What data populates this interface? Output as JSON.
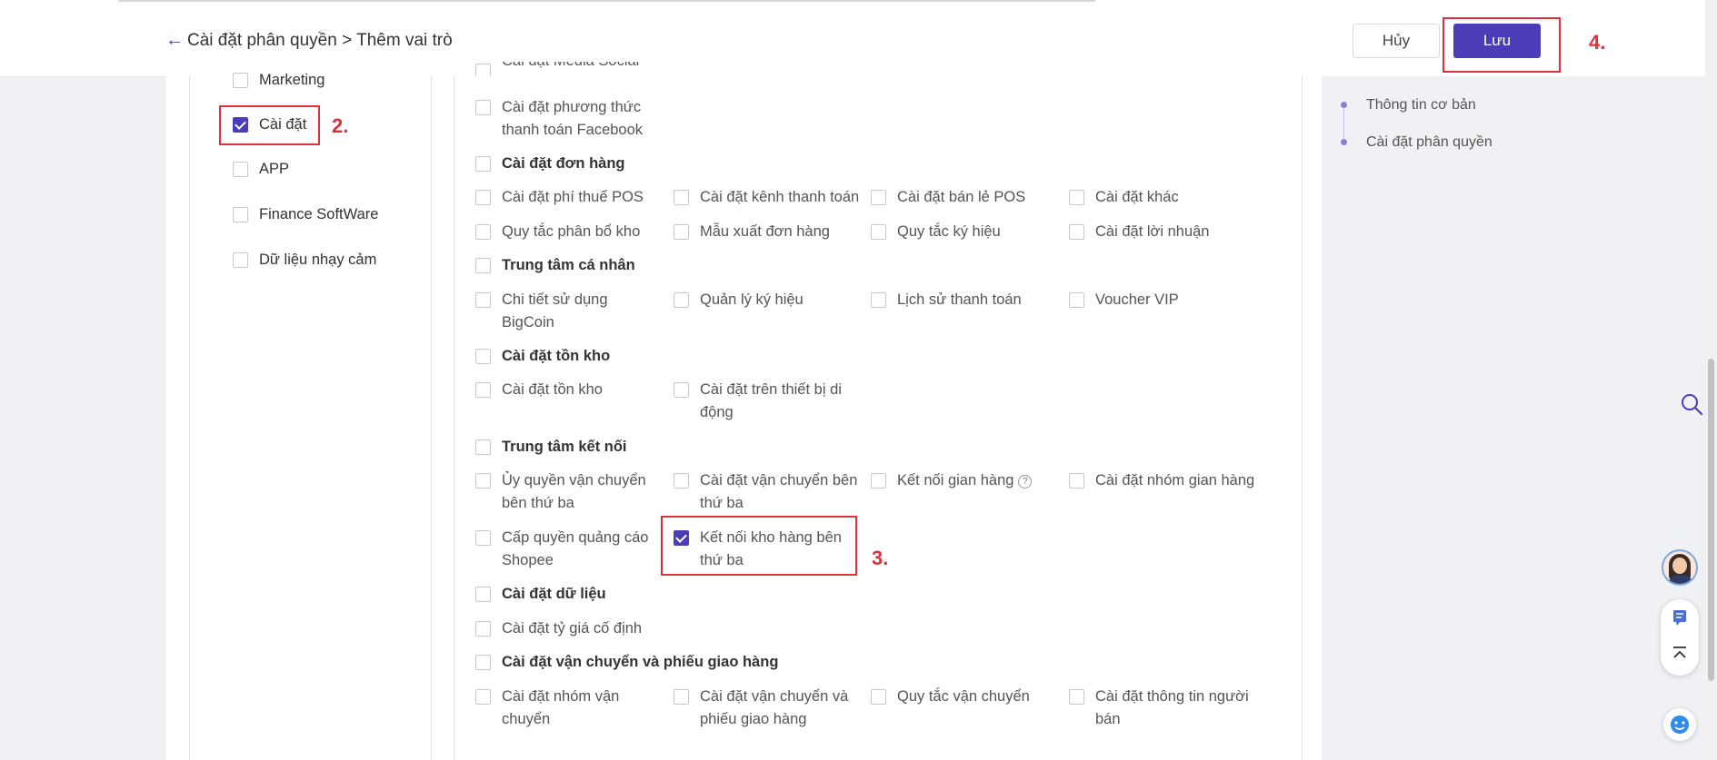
{
  "header": {
    "back_arrow": "←",
    "breadcrumb": "Cài đặt phân quyền > Thêm vai trò",
    "cancel_label": "Hủy",
    "save_label": "Lưu"
  },
  "steps": {
    "step2": "2.",
    "step3": "3.",
    "step4": "4."
  },
  "left_menu": [
    {
      "label": "Marketing",
      "checked": false
    },
    {
      "label": "Cài đặt",
      "checked": true
    },
    {
      "label": "APP",
      "checked": false
    },
    {
      "label": "Finance SoftWare",
      "checked": false
    },
    {
      "label": "Dữ liệu nhạy cảm",
      "checked": false
    }
  ],
  "permissions": {
    "social_partial": "Cài đặt Media Social",
    "payment_facebook": "Cài đặt phương thức thanh toán Facebook",
    "orders": {
      "title": "Cài đặt đơn hàng",
      "items": [
        "Cài đặt phí thuế POS",
        "Cài đặt kênh thanh toán",
        "Cài đặt bán lẻ POS",
        "Cài đặt khác",
        "Quy tắc phân bổ kho",
        "Mẫu xuất đơn hàng",
        "Quy tắc ký hiệu",
        "Cài đặt lời nhuận"
      ]
    },
    "personal": {
      "title": "Trung tâm cá nhân",
      "items": [
        "Chi tiết sử dụng BigCoin",
        "Quản lý ký hiệu",
        "Lịch sử thanh toán",
        "Voucher VIP"
      ]
    },
    "inventory": {
      "title": "Cài đặt tồn kho",
      "items": [
        "Cài đặt tồn kho",
        "Cài đặt trên thiết bị di động"
      ]
    },
    "connect": {
      "title": "Trung tâm kết nối",
      "items": [
        "Ủy quyền vận chuyển bên thứ ba",
        "Cài đặt vận chuyển bên thứ ba",
        "Kết nối gian hàng",
        "Cài đặt nhóm gian hàng",
        "Cấp quyền quảng cáo Shopee",
        "Kết nối kho hàng bên thứ ba"
      ],
      "help_icon": "?"
    },
    "data": {
      "title": "Cài đặt dữ liệu",
      "items": [
        "Cài đặt tỷ giá cố định"
      ]
    },
    "shipping": {
      "title": "Cài đặt vận chuyển và phiếu giao hàng",
      "items": [
        "Cài đặt nhóm vận chuyển",
        "Cài đặt vận chuyển và phiếu giao hàng",
        "Quy tắc vận chuyển",
        "Cài đặt thông tin người bán"
      ]
    }
  },
  "toc": {
    "items": [
      "Thông tin cơ bản",
      "Cài đặt phân quyền"
    ]
  },
  "colors": {
    "accent": "#4b3cb8",
    "highlight": "#e0303a"
  },
  "icons": [
    "back-arrow-icon",
    "checkbox-icon",
    "help-icon",
    "search-icon",
    "avatar",
    "feedback-icon",
    "back-to-top-icon",
    "helper-icon"
  ]
}
